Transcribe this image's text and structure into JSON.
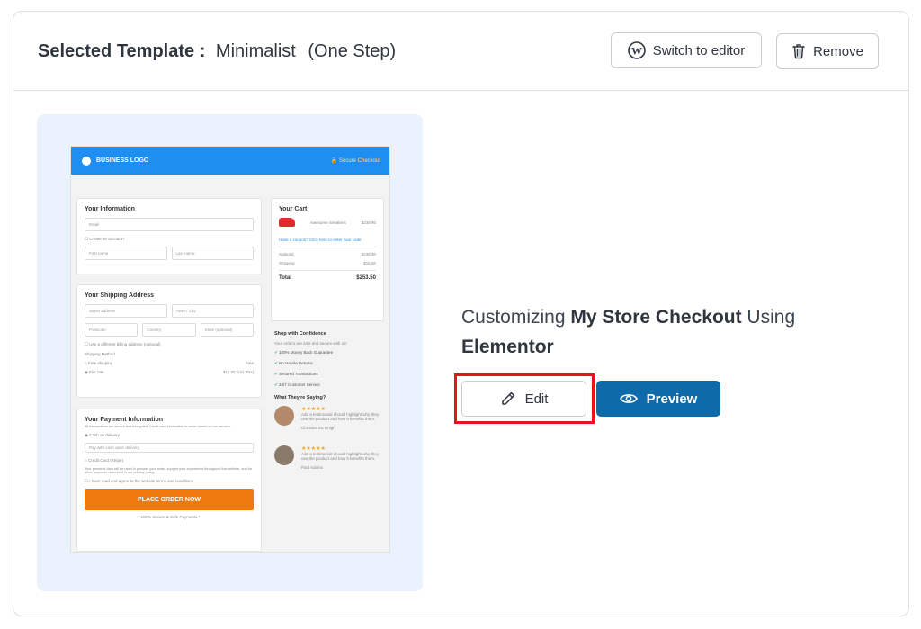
{
  "header": {
    "label": "Selected Template :",
    "template_name": "Minimalist",
    "template_variant": "(One Step)",
    "switch_label": "Switch to editor",
    "remove_label": "Remove"
  },
  "preview": {
    "logo": "BUSINESS LOGO",
    "secure": "🔒 Secure Checkout",
    "info_title": "Your Information",
    "email": "Email",
    "create_account": "☐ Create an account?",
    "first_name": "First name",
    "last_name": "Last name",
    "shipping_title": "Your Shipping Address",
    "street": "Street address",
    "town": "Town / City",
    "postcode": "Postcode",
    "country": "Country",
    "state": "State (optional)",
    "diff_billing": "☐ Use a different billing address (optional)",
    "shipping_method": "Shipping Method",
    "free_shipping": "○ Free shipping",
    "free_price": "Free",
    "flat_rate": "◉ Flat rate",
    "flat_price": "$15.00 (incl. Tax)",
    "payment_title": "Your Payment Information",
    "payment_note": "All transactions are secure and encrypted. Credit card information is never stored on our servers.",
    "cod": "◉ Cash on delivery",
    "pay_cash": "Pay with cash upon delivery.",
    "credit_card": "○ Credit Card (Stripe)",
    "personal_data": "Your personal data will be used to process your order, support your experience throughout this website, and for other purposes described in our privacy policy.",
    "terms": "☐ I have read and agree to the website terms and conditions",
    "place_order": "PLACE ORDER NOW",
    "secure_payments": "* 100% Secure & Safe Payments *",
    "cart_title": "Your Cart",
    "product": "Awesome Sneakers",
    "product_price": "$238.90",
    "coupon": "Have a coupon? Click here to enter your code",
    "subtotal_label": "Subtotal",
    "subtotal": "$238.90",
    "shipping_label": "Shipping",
    "shipping": "$15.00",
    "total_label": "Total",
    "total": "$253.50",
    "confidence_title": "Shop with Confidence",
    "confidence_sub": "Your orders are safe and secure with us!",
    "guarantees": [
      "100% Money Back Guarantee",
      "No Hassle Returns",
      "Secured Transactions",
      "24/7 Customer Service"
    ],
    "testimonials_title": "What They're Saying?",
    "stars": "★★★★★",
    "testimonial_text": "Add a testimonial should highlight why they use the product and how it benefits them.",
    "author1": "Christina Mc Knigh",
    "author2": "Paul Adams"
  },
  "cta": {
    "prefix": "Customizing ",
    "store": "My Store Checkout",
    "middle": " Using",
    "builder": "Elementor",
    "edit_label": "Edit",
    "preview_label": "Preview"
  },
  "colors": {
    "edit_highlight": "#e8131b",
    "preview_button": "#0e6aa8",
    "preview_bg": "#eaf2fd",
    "mock_header": "#1e8ef1",
    "place_order": "#f0790f"
  }
}
